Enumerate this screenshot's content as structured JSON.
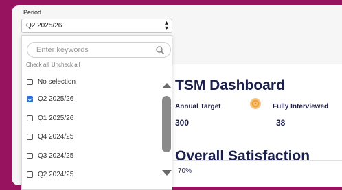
{
  "period": {
    "label": "Period",
    "selected": "Q2 2025/26",
    "search_placeholder": "Enter keywords",
    "check_all": "Check all",
    "uncheck_all": "Uncheck all",
    "options": [
      {
        "label": "No selection",
        "checked": false
      },
      {
        "label": "Q2 2025/26",
        "checked": true
      },
      {
        "label": "Q1 2025/26",
        "checked": false
      },
      {
        "label": "Q4 2024/25",
        "checked": false
      },
      {
        "label": "Q3 2024/25",
        "checked": false
      },
      {
        "label": "Q2 2024/25",
        "checked": false
      }
    ]
  },
  "dashboard": {
    "title": "TSM Dashboard",
    "metrics": [
      {
        "label": "Annual Target",
        "value": "300"
      },
      {
        "label": "Fully Interviewed",
        "value": "38"
      }
    ],
    "section_title": "Overall Satisfaction",
    "percent": "70%"
  },
  "icons": {
    "search": "search-icon",
    "target": "target-icon",
    "dropdown": "chevron-updown-icon"
  },
  "colors": {
    "brand": "#98135f",
    "title": "#1b1f4b",
    "checkbox": "#2a6fdb",
    "target_icon": "#f0a33a"
  }
}
